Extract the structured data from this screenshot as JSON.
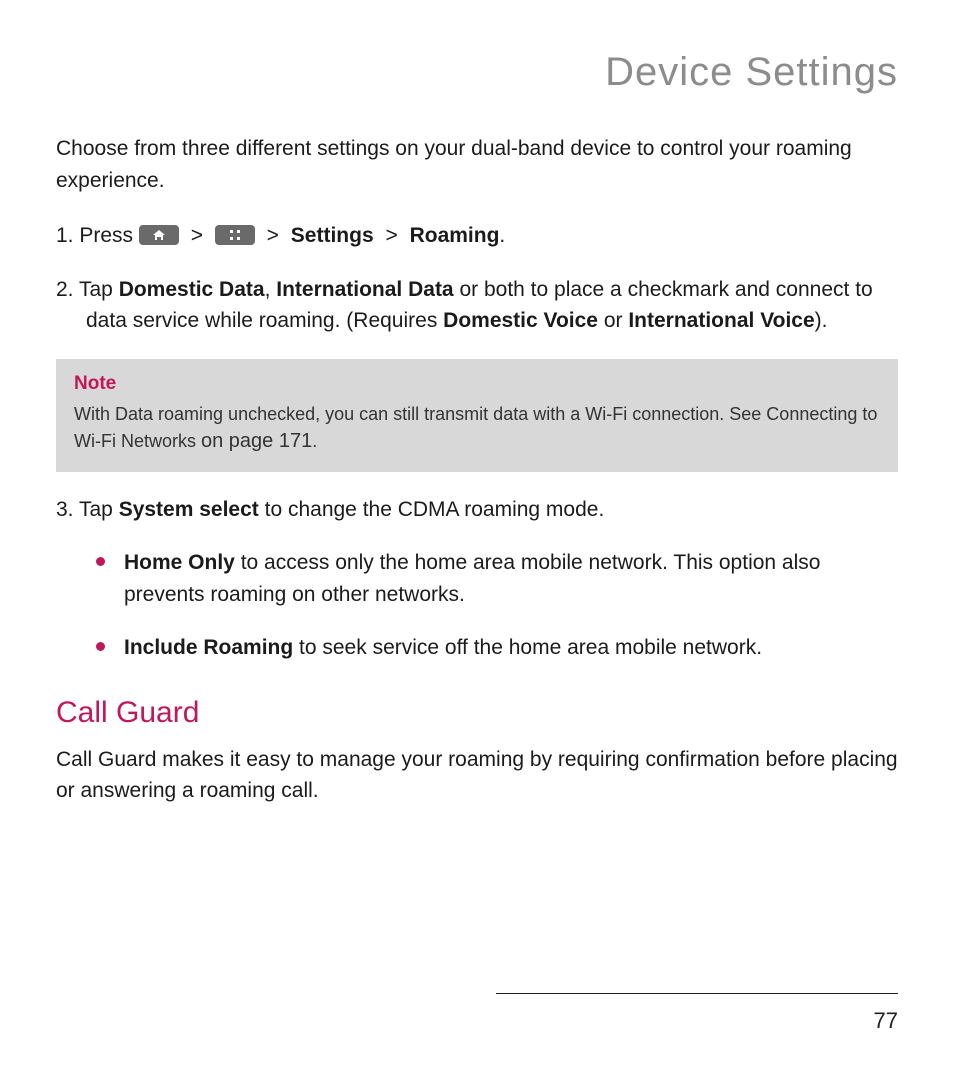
{
  "page_title": "Device Settings",
  "intro": "Choose from three different settings on your dual-band device to control your roaming experience.",
  "steps": {
    "s1": {
      "num": "1.",
      "prefix": "Press ",
      "gt": ">",
      "settings": "Settings",
      "roaming": "Roaming",
      "period": "."
    },
    "s2": {
      "num": "2.",
      "t1": "Tap ",
      "b1": "Domestic Data",
      "t2": ", ",
      "b2": "International Data",
      "t3": " or both to place a checkmark and connect to data service while roaming. (Requires ",
      "b3": "Domestic Voice",
      "t4": " or ",
      "b4": "International Voice",
      "t5": ")."
    },
    "s3": {
      "num": "3.",
      "t1": " Tap ",
      "b1": "System select",
      "t2": " to change the CDMA roaming mode."
    }
  },
  "note": {
    "title": "Note",
    "body1": "With Data roaming unchecked, you can still transmit data with a Wi-Fi connection. See Connecting to Wi-Fi Networks ",
    "body2": "on page 171",
    "body3": "."
  },
  "bullets": {
    "b1": {
      "bold": "Home Only",
      "rest": " to access only the home area mobile network. This option also prevents roaming on other networks."
    },
    "b2": {
      "bold": "Include Roaming",
      "rest": " to seek service off the home area mobile network."
    }
  },
  "section": {
    "heading": "Call Guard",
    "body": "Call Guard makes it easy to manage your roaming by requiring confirmation before placing or answering a roaming call."
  },
  "page_number": "77"
}
